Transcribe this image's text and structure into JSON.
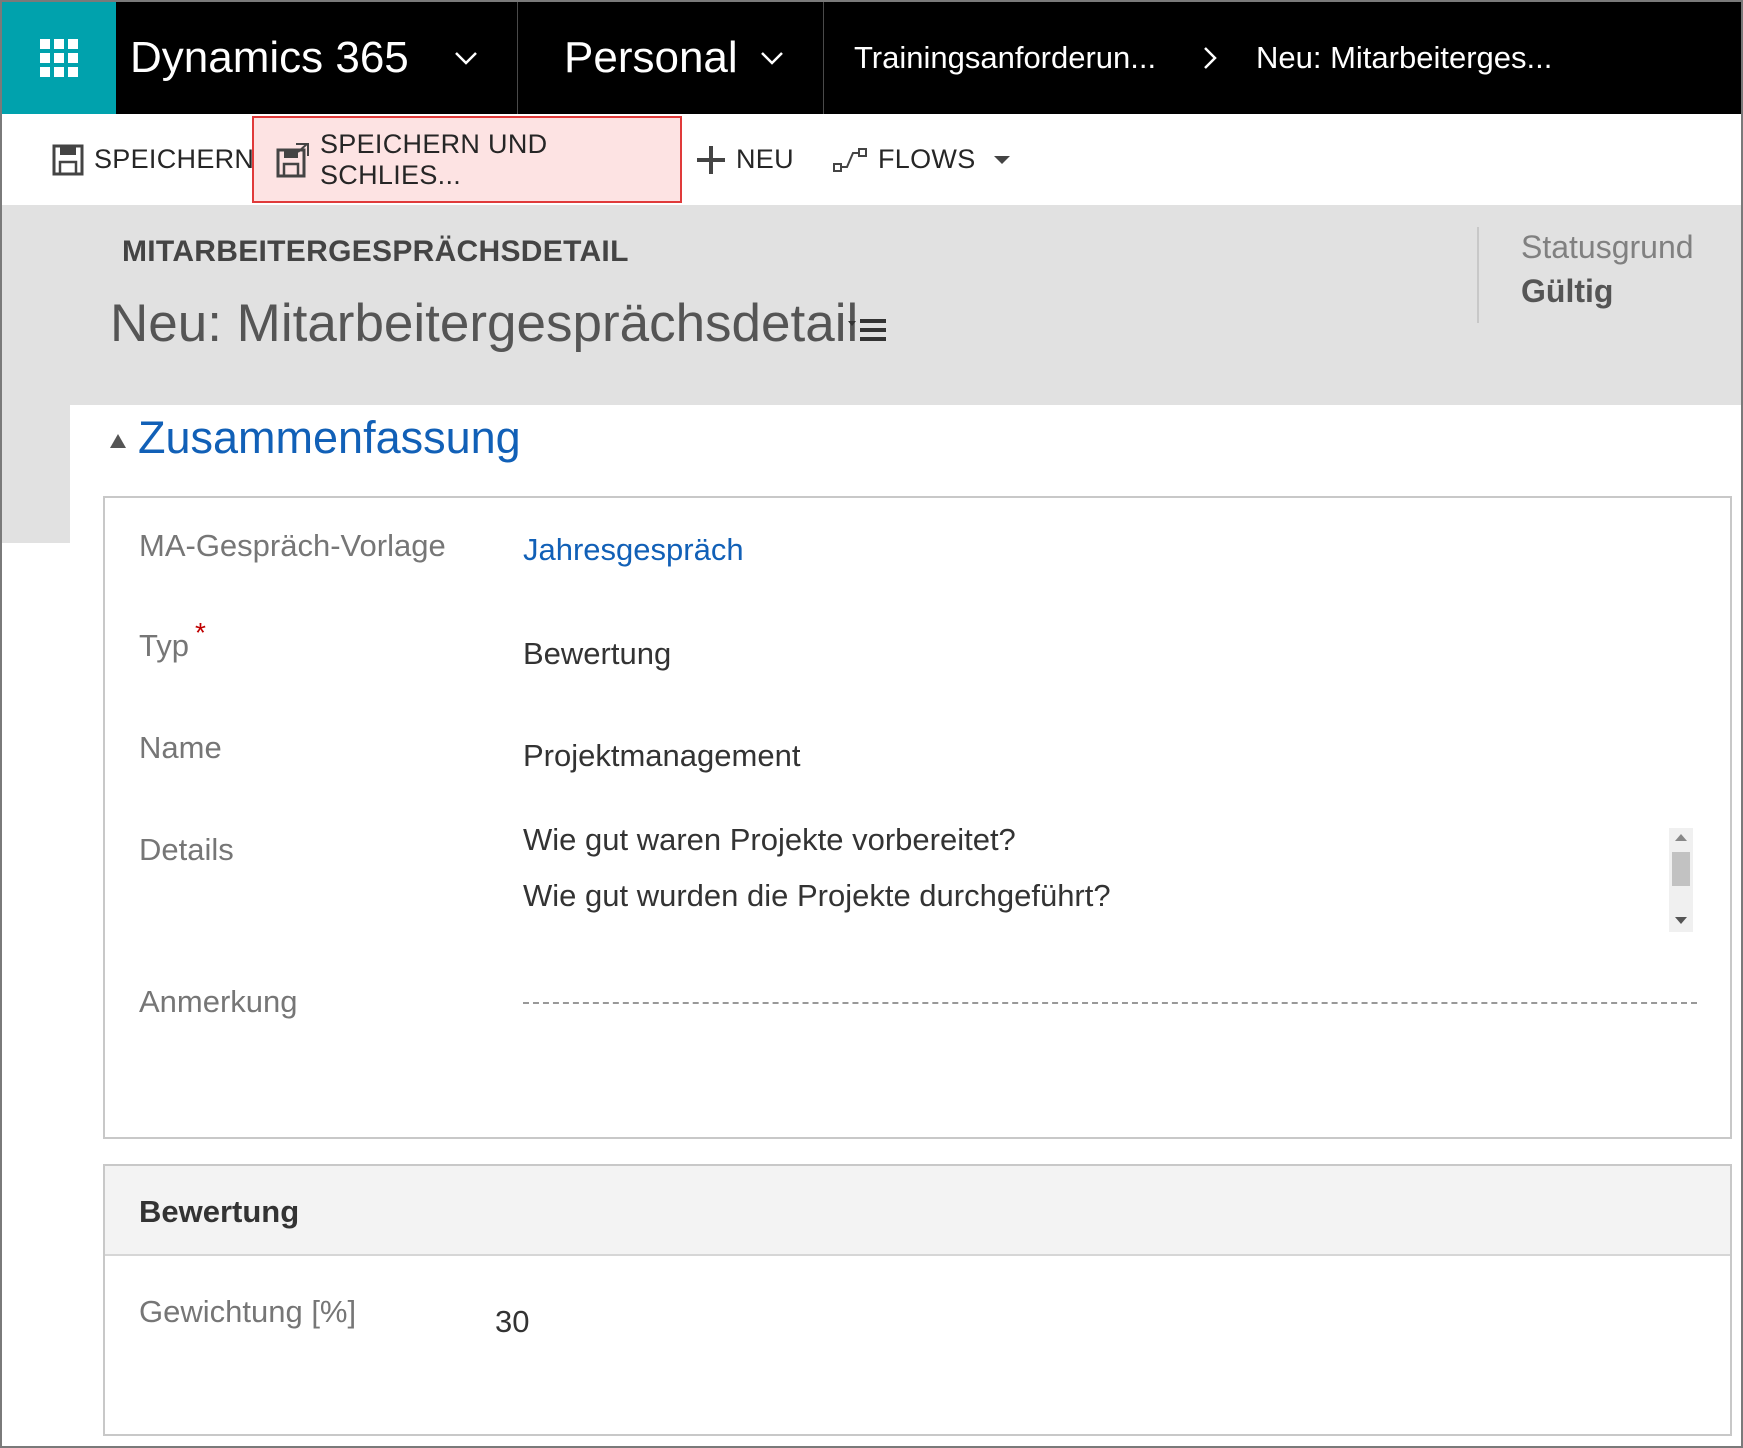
{
  "nav": {
    "app_name": "Dynamics 365",
    "module": "Personal",
    "breadcrumbs": [
      "Trainingsanforderun...",
      "Neu: Mitarbeiterges..."
    ]
  },
  "commands": {
    "save": "SPEICHERN",
    "save_close": "SPEICHERN UND SCHLIES...",
    "new": "NEU",
    "flows": "FLOWS"
  },
  "header": {
    "entity_type": "MITARBEITERGESPRÄCHSDETAIL",
    "title": "Neu: Mitarbeitergesprächsdetail",
    "status_label": "Statusgrund",
    "status_value": "Gültig"
  },
  "summary": {
    "section_title": "Zusammenfassung",
    "fields": {
      "template": {
        "label": "MA-Gespräch-Vorlage",
        "value": "Jahresgespräch"
      },
      "type": {
        "label": "Typ",
        "required_marker": "*",
        "value": "Bewertung"
      },
      "name": {
        "label": "Name",
        "value": "Projektmanagement"
      },
      "details": {
        "label": "Details",
        "lines": [
          "Wie gut waren Projekte vorbereitet?",
          "Wie gut wurden die Projekte durchgeführt?"
        ]
      },
      "remark": {
        "label": "Anmerkung",
        "value": ""
      }
    }
  },
  "rating": {
    "section_title": "Bewertung",
    "weight_label": "Gewichtung [%]",
    "weight_value": "30"
  },
  "colors": {
    "accent_teal": "#00a2ad",
    "link_blue": "#1160b7",
    "highlight_red": "#e03a3a",
    "required_red": "#c00000"
  }
}
